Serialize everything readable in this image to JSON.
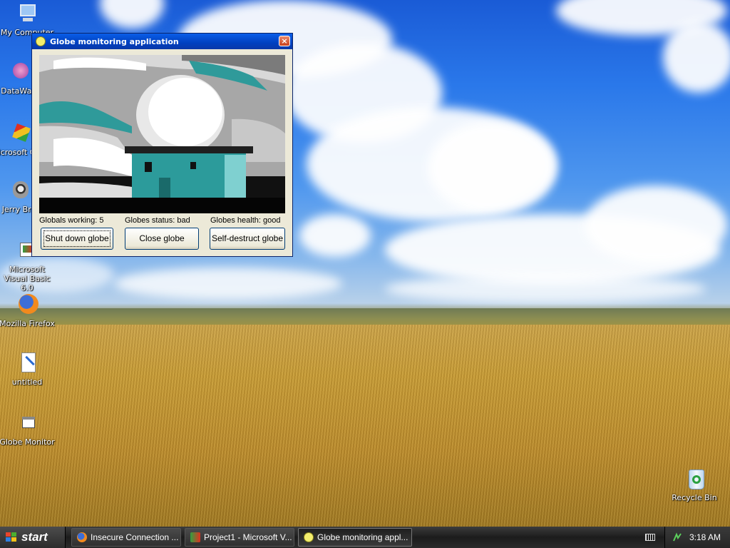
{
  "desktop": {
    "icons": [
      {
        "label": "My Computer",
        "icon": "computer-icon"
      },
      {
        "label": "DataWa...",
        "icon": "datawave-icon"
      },
      {
        "label": "Microsoft C++",
        "icon": "visual-cpp-icon"
      },
      {
        "label": "Jerry Br...",
        "icon": "raccoon-icon"
      },
      {
        "label": "Microsoft Visual Basic 6.0",
        "icon": "visual-basic-icon"
      },
      {
        "label": "Mozilla Firefox",
        "icon": "firefox-icon"
      },
      {
        "label": "untitled",
        "icon": "paint-file-icon"
      },
      {
        "label": "Globe Monitor",
        "icon": "application-icon"
      },
      {
        "label": "Recycle Bin",
        "icon": "recycle-bin-icon"
      }
    ]
  },
  "window": {
    "title": "Globe monitoring application",
    "close_label": "×",
    "status": {
      "globals_working": "Globals working: 5",
      "globes_status": "Globes status:  bad",
      "globes_health": "Globes health: good"
    },
    "buttons": {
      "shutdown": "Shut down globe",
      "close": "Close globe",
      "self_destruct": "Self-destruct globe"
    }
  },
  "taskbar": {
    "start_label": "start",
    "tasks": [
      {
        "label": "Insecure Connection ...",
        "icon": "firefox-icon"
      },
      {
        "label": "Project1 - Microsoft V...",
        "icon": "visual-basic-icon"
      },
      {
        "label": "Globe monitoring appl...",
        "icon": "globe-app-icon"
      }
    ],
    "clock": "3:18 AM"
  },
  "colors": {
    "titlebar": "#0a5ee8",
    "window_bg": "#ece9d8",
    "taskbar": "#2a2a2a",
    "button_border": "#003c74"
  }
}
